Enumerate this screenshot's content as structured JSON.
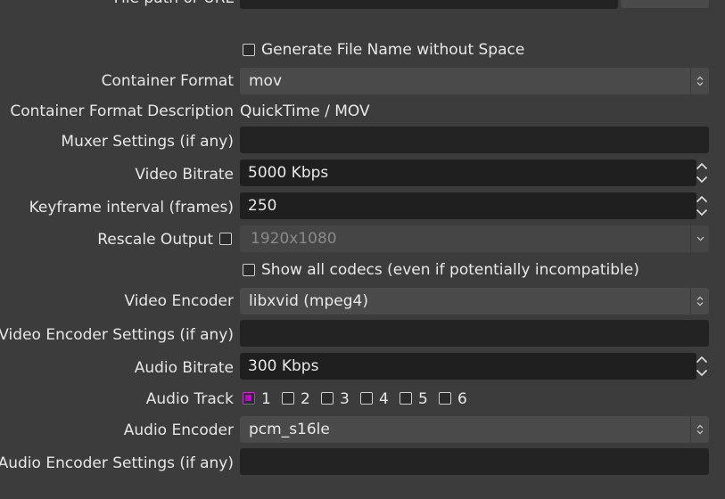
{
  "top_row": {
    "label": "File path or URL"
  },
  "generate_filename": {
    "label": "Generate File Name without Space",
    "checked": false
  },
  "container_format": {
    "label": "Container Format",
    "value": "mov"
  },
  "container_format_description": {
    "label": "Container Format Description",
    "value": "QuickTime / MOV"
  },
  "muxer_settings": {
    "label": "Muxer Settings (if any)",
    "value": ""
  },
  "video_bitrate": {
    "label": "Video Bitrate",
    "value": "5000 Kbps"
  },
  "keyframe_interval": {
    "label": "Keyframe interval (frames)",
    "value": "250"
  },
  "rescale_output": {
    "label": "Rescale Output",
    "checked": false,
    "value": "1920x1080"
  },
  "show_all_codecs": {
    "label": "Show all codecs (even if potentially incompatible)",
    "checked": false
  },
  "video_encoder": {
    "label": "Video Encoder",
    "value": "libxvid (mpeg4)"
  },
  "video_encoder_settings": {
    "label": "Video Encoder Settings (if any)",
    "value": ""
  },
  "audio_bitrate": {
    "label": "Audio Bitrate",
    "value": "300 Kbps"
  },
  "audio_track": {
    "label": "Audio Track",
    "tracks": [
      {
        "label": "1",
        "checked": true
      },
      {
        "label": "2",
        "checked": false
      },
      {
        "label": "3",
        "checked": false
      },
      {
        "label": "4",
        "checked": false
      },
      {
        "label": "5",
        "checked": false
      },
      {
        "label": "6",
        "checked": false
      }
    ]
  },
  "audio_encoder": {
    "label": "Audio Encoder",
    "value": "pcm_s16le"
  },
  "audio_encoder_settings": {
    "label": "Audio Encoder Settings (if any)",
    "value": ""
  },
  "colors": {
    "accent": "#c600cf",
    "background": "#3c3c3c",
    "field": "#232323",
    "combo": "#4a4a4a"
  }
}
